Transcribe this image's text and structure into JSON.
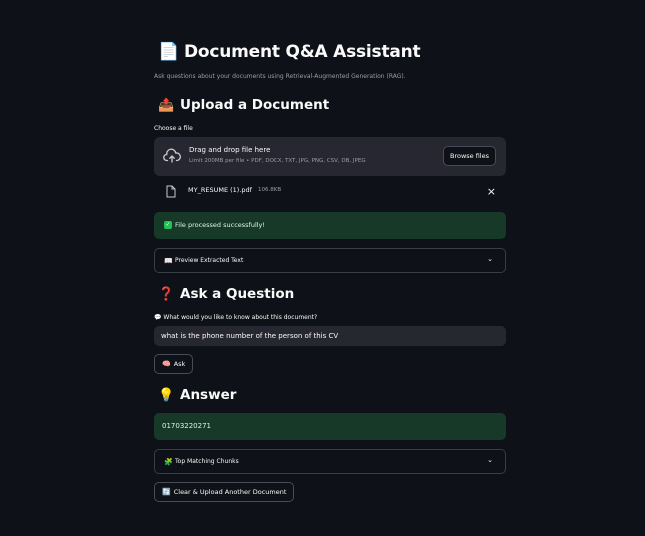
{
  "header": {
    "title_emoji": "📄",
    "title": "Document Q&A Assistant",
    "subtitle": "Ask questions about your documents using Retrieval-Augmented Generation (RAG)."
  },
  "upload": {
    "heading_emoji": "📤",
    "heading": "Upload a Document",
    "label": "Choose a file",
    "dropzone_title": "Drag and drop file here",
    "dropzone_limit": "Limit 200MB per file • PDF, DOCX, TXT, JPG, PNG, CSV, DB, JPEG",
    "browse_label": "Browse files",
    "file_name": "MY_RESUME (1).pdf",
    "file_size": "106.8KB",
    "close_icon": "×",
    "success_icon": "✓",
    "success_text": "File processed successfully!",
    "preview_icon": "📖",
    "preview_label": "Preview Extracted Text",
    "chevron": "⌄"
  },
  "ask": {
    "heading_emoji": "❓",
    "heading": "Ask a Question",
    "input_label_icon": "💬",
    "input_label": "What would you like to know about this document?",
    "input_value": "what is the phone number of the person of this CV",
    "ask_icon": "🧠",
    "ask_label": "Ask"
  },
  "answer": {
    "heading_emoji": "💡",
    "heading": "Answer",
    "text": "01703220271",
    "chunks_icon": "🧩",
    "chunks_label": "Top Matching Chunks",
    "chevron": "⌄",
    "clear_icon": "🔄",
    "clear_label": "Clear & Upload Another Document"
  },
  "colors": {
    "background": "#0e1117",
    "surface": "#262730",
    "success_bg": "#173928",
    "text": "#fafafa",
    "muted": "#9a9ea6"
  }
}
